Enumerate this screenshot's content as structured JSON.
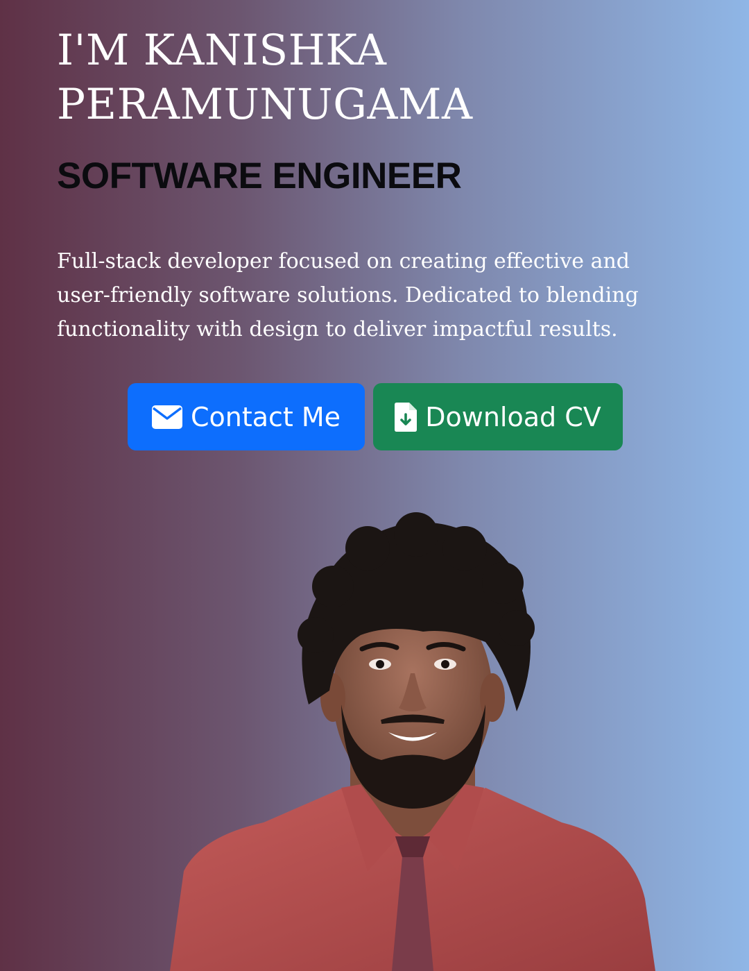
{
  "hero": {
    "title_line_1": "I'M KANISHKA",
    "title_line_2": "PERAMUNUGAMA",
    "role": "SOFTWARE ENGINEER",
    "description_lines": [
      "Full-stack developer focused on creating effective and",
      "user-friendly software solutions. Dedicated to blending",
      "functionality with design to deliver impactful results."
    ]
  },
  "buttons": {
    "contact": {
      "label": "Contact Me",
      "icon": "envelope-icon",
      "color": "#0d6efd"
    },
    "download": {
      "label": "Download CV",
      "icon": "file-download-icon",
      "color": "#198754"
    }
  },
  "colors": {
    "background_left": "#5f3146",
    "background_right": "#8fb6e6",
    "title": "#ffffff",
    "role": "#0b0b0f"
  },
  "portrait": {
    "icon": "profile-photo"
  }
}
